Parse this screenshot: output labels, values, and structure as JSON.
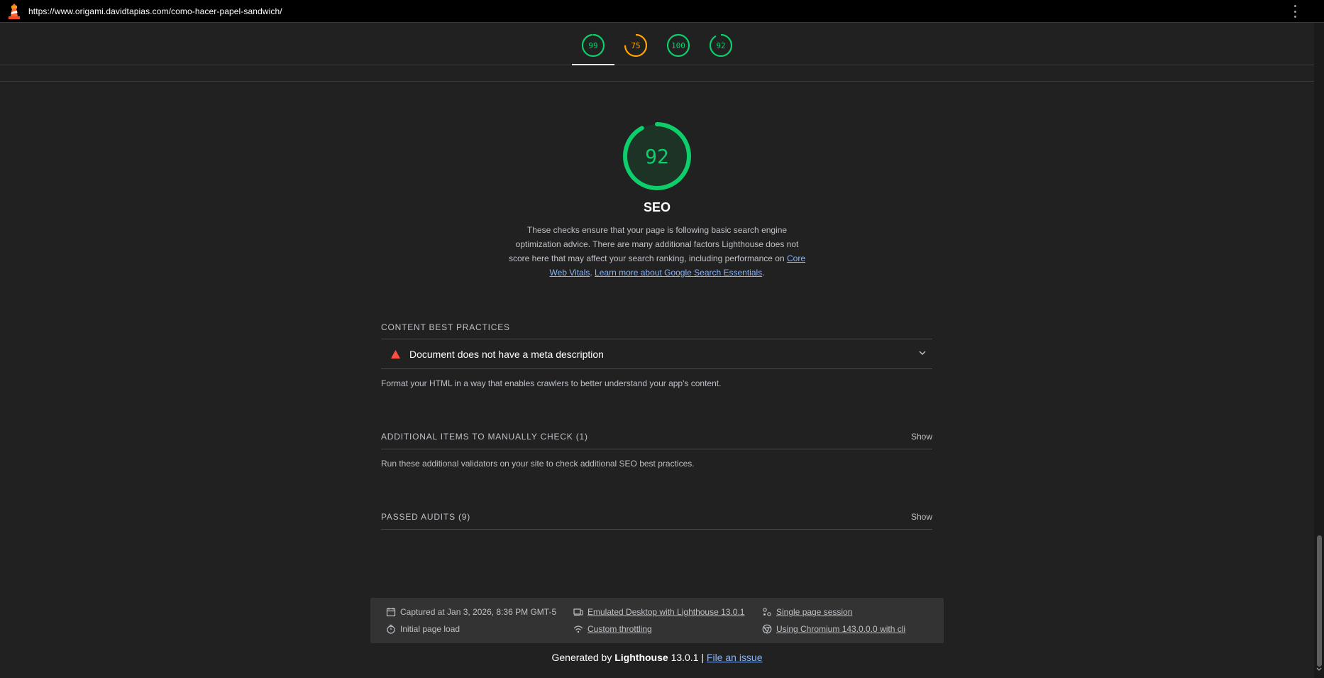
{
  "topbar": {
    "url": "https://www.origami.davidtapias.com/como-hacer-papel-sandwich/"
  },
  "scores": [
    {
      "value": "99",
      "fraction": 0.99,
      "color": "#0cce6b"
    },
    {
      "value": "75",
      "fraction": 0.75,
      "color": "#ffa400"
    },
    {
      "value": "100",
      "fraction": 1.0,
      "color": "#0cce6b"
    },
    {
      "value": "92",
      "fraction": 0.92,
      "color": "#0cce6b"
    }
  ],
  "category": {
    "score": "92",
    "score_fraction": 0.92,
    "title": "SEO",
    "description_text": "These checks ensure that your page is following basic search engine optimization advice. There are many additional factors Lighthouse does not score here that may affect your search ranking, including performance on",
    "link1": "Core Web Vitals",
    "sep": ". ",
    "link2": "Learn more about Google Search Essentials",
    "end": "."
  },
  "groups": {
    "content": {
      "title": "CONTENT BEST PRACTICES",
      "audit_title": "Document does not have a meta description",
      "description": "Format your HTML in a way that enables crawlers to better understand your app's content."
    },
    "manual": {
      "title": "ADDITIONAL ITEMS TO MANUALLY CHECK",
      "count": "(1)",
      "show": "Show",
      "description": "Run these additional validators on your site to check additional SEO best practices."
    },
    "passed": {
      "title": "PASSED AUDITS",
      "count": "(9)",
      "show": "Show"
    }
  },
  "env": {
    "captured": "Captured at Jan 3, 2026, 8:36 PM GMT-5",
    "load": "Initial page load",
    "device": "Emulated Desktop with Lighthouse 13.0.1",
    "throttling": "Custom throttling",
    "session": "Single page session",
    "browser": "Using Chromium 143.0.0.0 with cli"
  },
  "footer": {
    "generated_by": "Generated by",
    "brand": "Lighthouse",
    "version": "13.0.1 |",
    "issue": "File an issue"
  },
  "colors": {
    "pass": "#0cce6b",
    "average": "#ffa400",
    "fail": "#ff4e42",
    "link": "#8ab4f8"
  }
}
